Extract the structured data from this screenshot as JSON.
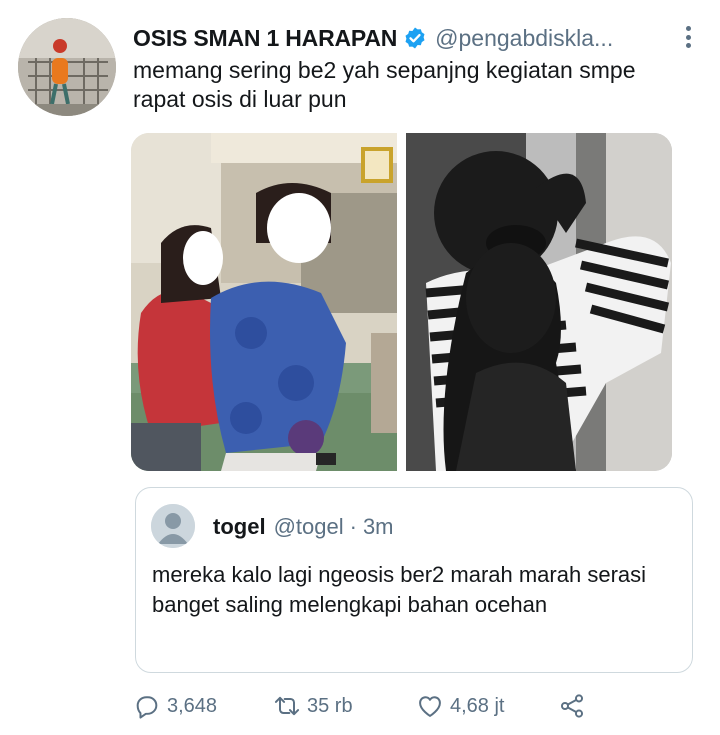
{
  "tweet": {
    "display_name": "OSIS SMAN 1 HARAPAN",
    "handle": "@pengabdiskla...",
    "text": "memang sering be2 yah sepanjng kegiatan smpe rapat osis di luar pun",
    "verified": true,
    "avatar_icon": "profile-photo",
    "media": [
      {
        "icon": "photo-two-people-campus"
      },
      {
        "icon": "photo-couple-striped-shirt"
      }
    ]
  },
  "quote": {
    "display_name": "togel",
    "handle": "@togel",
    "separator": "·",
    "time": "3m",
    "text": "mereka kalo lagi ngeosis ber2 marah marah serasi banget saling melengkapi bahan ocehan",
    "avatar_icon": "default-avatar-icon"
  },
  "actions": {
    "reply_count": "3,648",
    "retweet_count": "35 rb",
    "like_count": "4,68 jt",
    "reply_icon": "reply-icon",
    "retweet_icon": "retweet-icon",
    "like_icon": "heart-icon",
    "share_icon": "share-icon"
  },
  "colors": {
    "text_primary": "#14171a",
    "text_secondary": "#5b7083",
    "verified_blue": "#1da1f2",
    "border": "#cfd9de"
  }
}
